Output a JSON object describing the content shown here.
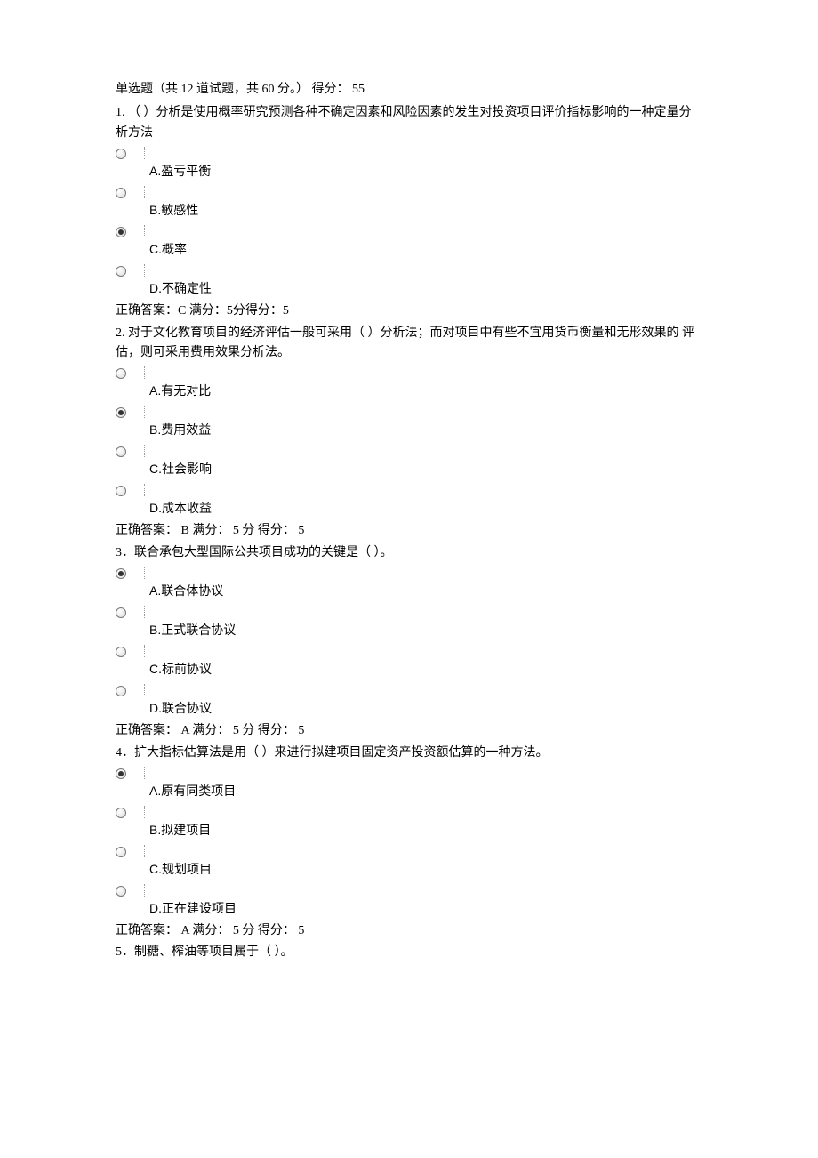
{
  "header": "单选题（共 12 道试题，共 60 分。） 得分： 55",
  "questions": [
    {
      "stem": "1. （ ）分析是使用概率研究预测各种不确定因素和风险因素的发生对投资项目评价指标影响的一种定量分 析方法",
      "options": [
        {
          "label": "A.盈亏平衡",
          "selected": false
        },
        {
          "label": "B.敏感性",
          "selected": false
        },
        {
          "label": "C.概率",
          "selected": true
        },
        {
          "label": "D.不确定性",
          "selected": false
        }
      ],
      "answer": "正确答案：C     满分：5分得分：5"
    },
    {
      "stem": "2. 对于文化教育项目的经济评估一般可采用（ ）分析法；而对项目中有些不宜用货币衡量和无形效果的 评估，则可采用费用效果分析法。",
      "options": [
        {
          "label": "A.有无对比",
          "selected": false
        },
        {
          "label": "B.费用效益",
          "selected": true
        },
        {
          "label": "C.社会影响",
          "selected": false
        },
        {
          "label": "D.成本收益",
          "selected": false
        }
      ],
      "answer": "正确答案： B 满分： 5 分 得分： 5"
    },
    {
      "stem": "3．联合承包大型国际公共项目成功的关键是（ ）。",
      "options": [
        {
          "label": "A.联合体协议",
          "selected": true
        },
        {
          "label": "B.正式联合协议",
          "selected": false
        },
        {
          "label": "C.标前协议",
          "selected": false
        },
        {
          "label": "D.联合协议",
          "selected": false
        }
      ],
      "answer": "正确答案： A 满分： 5 分 得分： 5"
    },
    {
      "stem": "4．扩大指标估算法是用（ ）来进行拟建项目固定资产投资额估算的一种方法。",
      "options": [
        {
          "label": "A.原有同类项目",
          "selected": true
        },
        {
          "label": "B.拟建项目",
          "selected": false
        },
        {
          "label": "C.规划项目",
          "selected": false
        },
        {
          "label": "D.正在建设项目",
          "selected": false
        }
      ],
      "answer": "正确答案： A 满分： 5 分 得分： 5"
    }
  ],
  "q5_stem": "5．制糖、榨油等项目属于（ ）。"
}
